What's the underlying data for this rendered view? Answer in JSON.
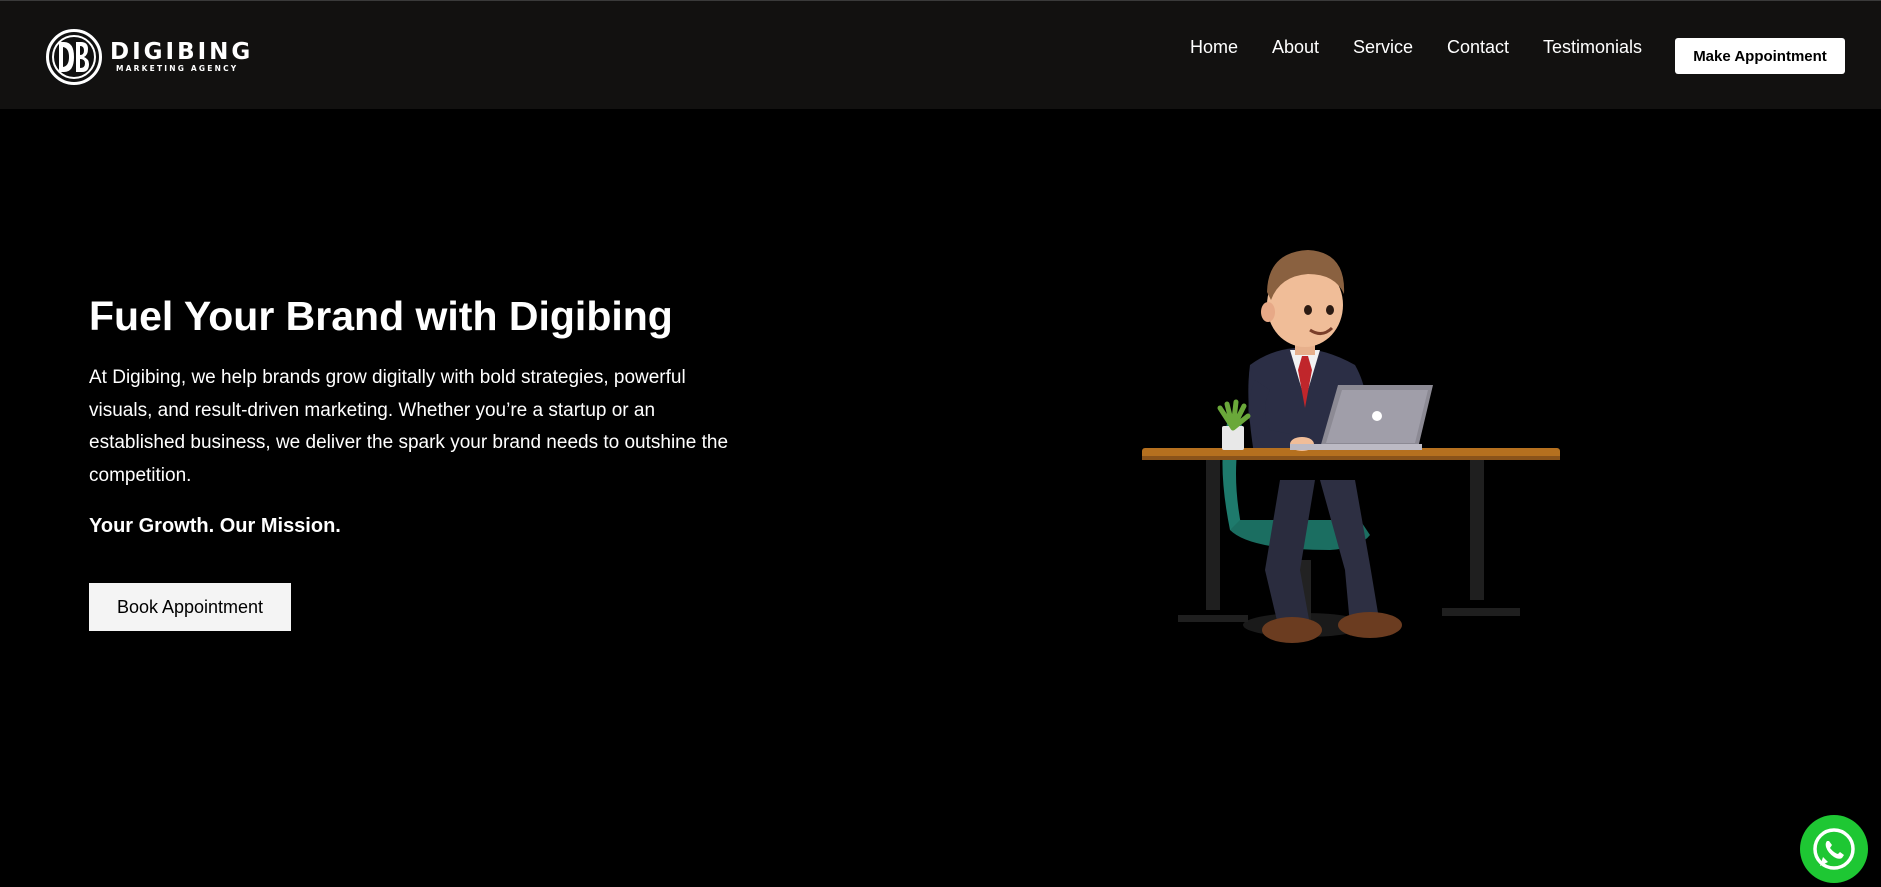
{
  "header": {
    "logo": {
      "name": "DIGIBING",
      "subtitle": "MARKETING AGENCY"
    },
    "nav": [
      {
        "label": "Home"
      },
      {
        "label": "About"
      },
      {
        "label": "Service"
      },
      {
        "label": "Contact"
      },
      {
        "label": "Testimonials"
      }
    ],
    "cta_label": "Make Appointment"
  },
  "hero": {
    "title": "Fuel Your Brand with Digibing",
    "description": "At Digibing, we help brands grow digitally with bold strategies, powerful visuals, and result-driven marketing. Whether you’re a startup or an established business, we deliver the spark your brand needs to outshine the competition.",
    "tagline": "Your Growth. Our Mission.",
    "button_label": "Book Appointment",
    "illustration": "businessman-at-laptop-desk-3d"
  },
  "floating": {
    "icon": "whatsapp-icon"
  },
  "colors": {
    "page_background": "#000000",
    "navbar_background": "#121110",
    "text": "#ffffff",
    "button_background": "#f4f4f4",
    "whatsapp": "#1ec733"
  }
}
